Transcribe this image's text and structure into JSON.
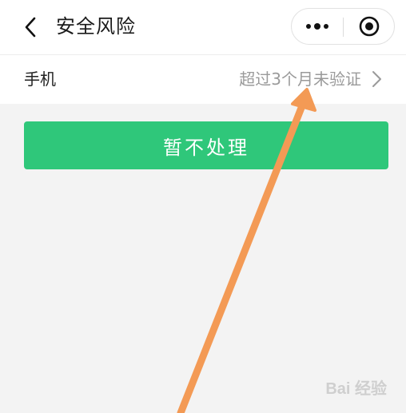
{
  "header": {
    "title": "安全风险",
    "back_icon": "chevron-left-icon",
    "more_icon": "more-dots-icon",
    "close_icon": "target-close-icon"
  },
  "settings_row": {
    "label": "手机",
    "value": "超过3个月未验证",
    "chevron_icon": "chevron-right-icon"
  },
  "primary_button": {
    "label": "暂不处理",
    "color": "#2fc77a"
  },
  "annotation": {
    "color": "#f39a55",
    "type": "arrow"
  },
  "watermark": {
    "text": "Bai 经验"
  }
}
